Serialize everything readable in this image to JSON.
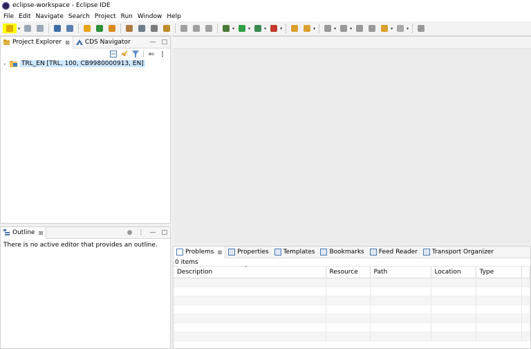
{
  "window": {
    "title": "eclipse-workspace - Eclipse IDE"
  },
  "menubar": [
    "File",
    "Edit",
    "Navigate",
    "Search",
    "Project",
    "Run",
    "Window",
    "Help"
  ],
  "toolbar": {
    "items": [
      {
        "name": "new-icon",
        "color": "#e0a800",
        "highlight": true,
        "dropdown": true
      },
      {
        "name": "save-icon",
        "color": "#9aa7b5"
      },
      {
        "name": "save-all-icon",
        "color": "#9aa7b5"
      },
      {
        "sep": true
      },
      {
        "name": "terminal-icon",
        "color": "#3b6ea5"
      },
      {
        "name": "search-icon",
        "color": "#5a7fae"
      },
      {
        "sep": true
      },
      {
        "name": "open-type-icon",
        "color": "#e8a317"
      },
      {
        "name": "new-project-icon",
        "color": "#2f8f3a"
      },
      {
        "name": "open-object-icon",
        "color": "#d98b20"
      },
      {
        "sep": true
      },
      {
        "name": "transport-icon",
        "color": "#b07a40"
      },
      {
        "name": "refresh-icon",
        "color": "#6d7d8c"
      },
      {
        "name": "print-icon",
        "color": "#7a7a7a"
      },
      {
        "name": "tool-icon",
        "color": "#c08b2a"
      },
      {
        "sep": true
      },
      {
        "name": "toggle-icon",
        "color": "#a0a0a0"
      },
      {
        "name": "mark-icon",
        "color": "#a0a0a0"
      },
      {
        "name": "pin-icon",
        "color": "#a0a0a0"
      },
      {
        "sep": true
      },
      {
        "name": "debug-icon",
        "color": "#4a7a3a",
        "dropdown": true
      },
      {
        "name": "run-icon",
        "color": "#2ea043",
        "dropdown": true
      },
      {
        "name": "coverage-icon",
        "color": "#3a8a50",
        "dropdown": true
      },
      {
        "name": "external-tools-icon",
        "color": "#c0392b",
        "dropdown": true
      },
      {
        "sep": true
      },
      {
        "name": "open-folder-icon",
        "color": "#d9a030"
      },
      {
        "name": "annotation-icon",
        "color": "#d9a030",
        "dropdown": true
      },
      {
        "sep": true
      },
      {
        "name": "next-annotation-icon",
        "color": "#999",
        "dropdown": true
      },
      {
        "name": "prev-annotation-icon",
        "color": "#999",
        "dropdown": true
      },
      {
        "name": "last-edit-icon",
        "color": "#999"
      },
      {
        "name": "back-edit-icon",
        "color": "#999"
      },
      {
        "name": "back-icon",
        "color": "#d9a030",
        "dropdown": true
      },
      {
        "name": "forward-icon",
        "color": "#aaa",
        "dropdown": true
      },
      {
        "sep": true
      },
      {
        "name": "pin-editor-icon",
        "color": "#999"
      }
    ]
  },
  "project_explorer": {
    "tabs": [
      {
        "label": "Project Explorer",
        "active": true,
        "close": "⊠"
      },
      {
        "label": "CDS Navigator",
        "active": false
      }
    ],
    "tree": [
      {
        "label": "TRL_EN [TRL, 100, CB9980000913, EN]"
      }
    ]
  },
  "outline": {
    "tab_label": "Outline",
    "message": "There is no active editor that provides an outline."
  },
  "bottom_panel": {
    "tabs": [
      {
        "label": "Problems",
        "icon": "problems-icon",
        "close": "⊠"
      },
      {
        "label": "Properties",
        "icon": "properties-icon"
      },
      {
        "label": "Templates",
        "icon": "templates-icon"
      },
      {
        "label": "Bookmarks",
        "icon": "bookmarks-icon"
      },
      {
        "label": "Feed Reader",
        "icon": "feed-reader-icon"
      },
      {
        "label": "Transport Organizer",
        "icon": "transport-organizer-icon"
      }
    ],
    "count": "0 items",
    "columns": [
      "Description",
      "Resource",
      "Path",
      "Location",
      "Type"
    ]
  },
  "colors": {
    "highlight": "#ffff00",
    "selection": "#cde8ff"
  }
}
